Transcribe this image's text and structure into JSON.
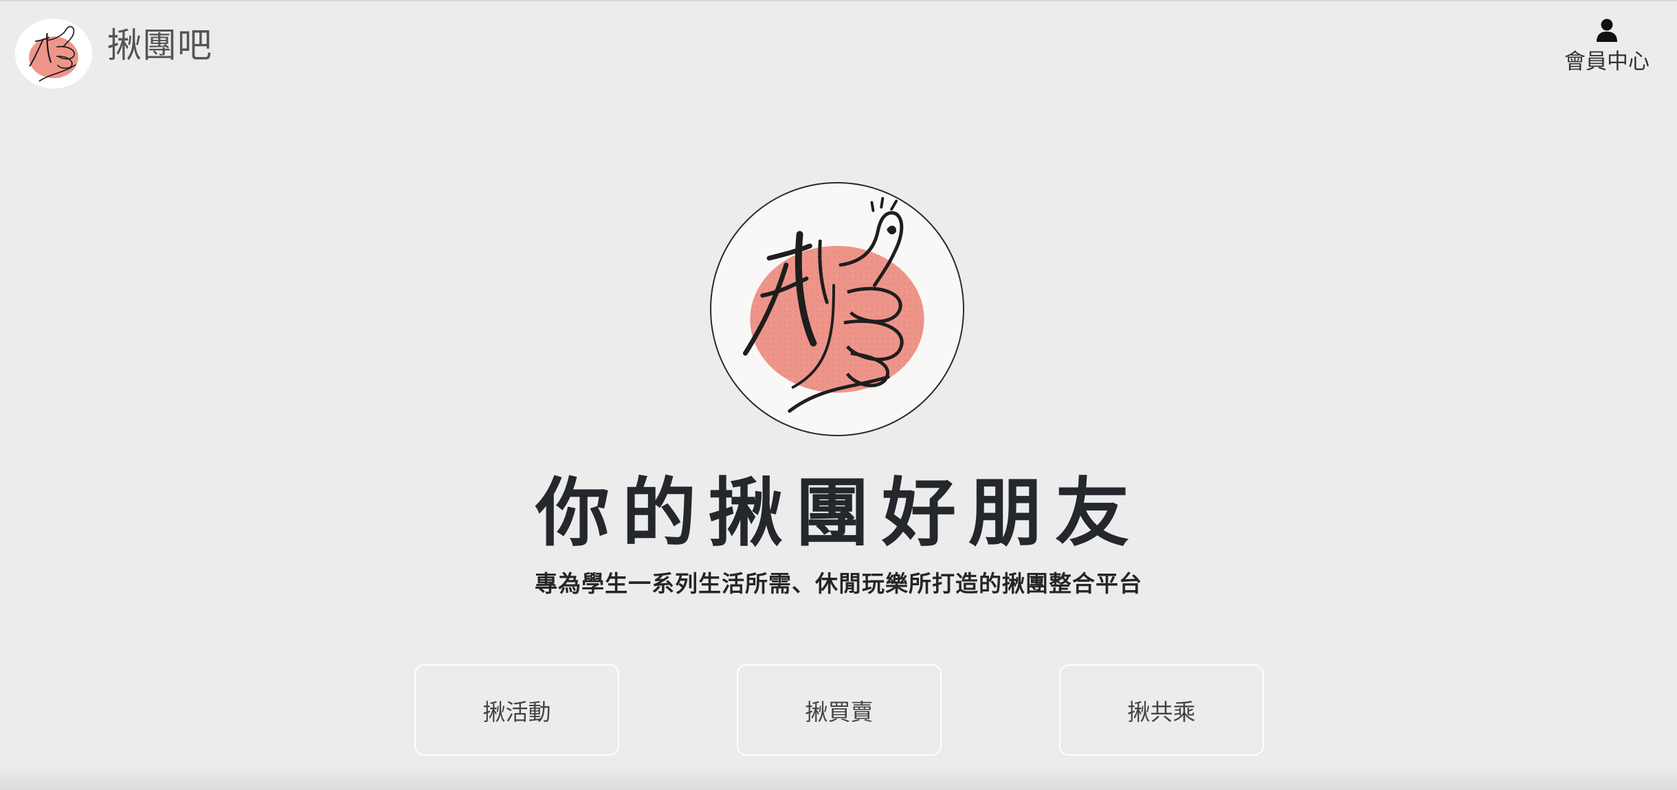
{
  "header": {
    "brand_name": "揪團吧",
    "member_label": "會員中心",
    "member_icon": "user-icon"
  },
  "hero": {
    "title": "你的揪團好朋友",
    "subtitle": "專為學生一系列生活所需、休閒玩樂所打造的揪團整合平台",
    "logo_text": "揪"
  },
  "nav": [
    {
      "label": "揪活動"
    },
    {
      "label": "揪買賣"
    },
    {
      "label": "揪共乘"
    }
  ],
  "colors": {
    "background": "#ececec",
    "accent_blob": "#ee958a",
    "text_dark": "#24272b"
  }
}
